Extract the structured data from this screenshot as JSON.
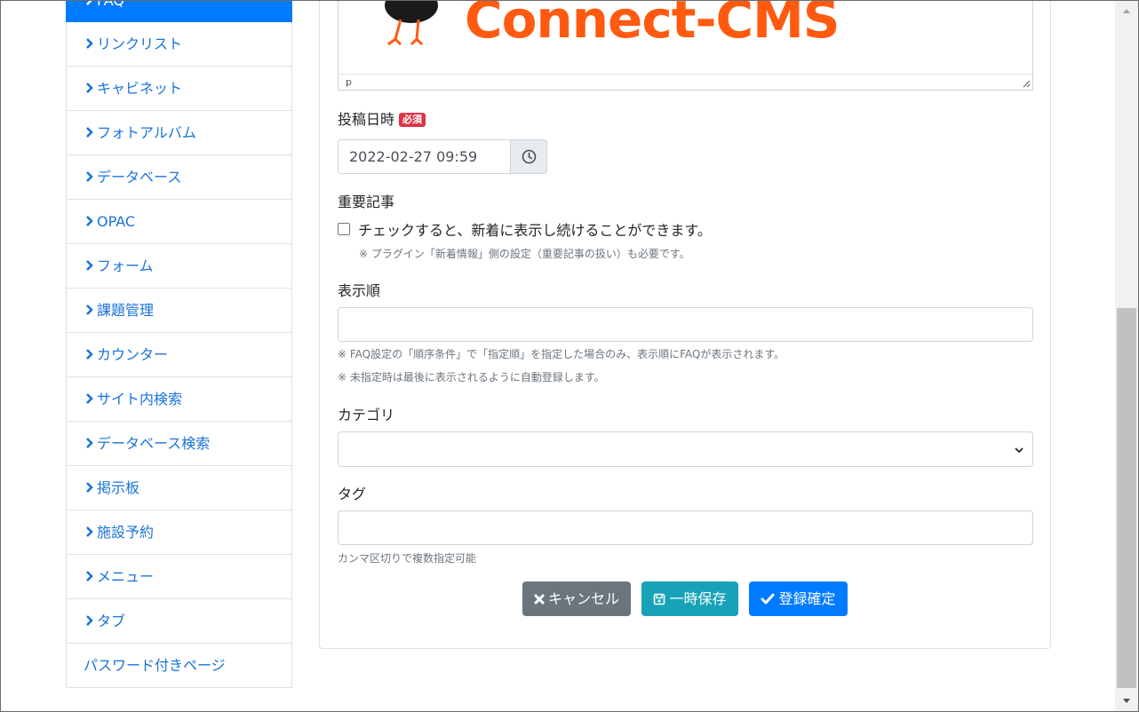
{
  "sidebar": {
    "items": [
      {
        "label": "FAQ",
        "active": true
      },
      {
        "label": "リンクリスト"
      },
      {
        "label": "キャビネット"
      },
      {
        "label": "フォトアルバム"
      },
      {
        "label": "データベース"
      },
      {
        "label": "OPAC"
      },
      {
        "label": "フォーム"
      },
      {
        "label": "課題管理"
      },
      {
        "label": "カウンター"
      },
      {
        "label": "サイト内検索"
      },
      {
        "label": "データベース検索"
      },
      {
        "label": "掲示板"
      },
      {
        "label": "施設予約"
      },
      {
        "label": "メニュー"
      },
      {
        "label": "タブ"
      },
      {
        "label": "パスワード付きページ",
        "plain": true
      }
    ]
  },
  "editor": {
    "logo_text": "Connect-CMS",
    "status_path": "p"
  },
  "form": {
    "posted_at": {
      "label": "投稿日時",
      "required_badge": "必須",
      "value": "2022-02-27 09:59"
    },
    "important": {
      "label": "重要記事",
      "checkbox_label": "チェックすると、新着に表示し続けることができます。",
      "note": "※ プラグイン「新着情報」側の設定（重要記事の扱い）も必要です。"
    },
    "display_order": {
      "label": "表示順",
      "value": "",
      "note1": "※ FAQ設定の「順序条件」で「指定順」を指定した場合のみ、表示順にFAQが表示されます。",
      "note2": "※ 未指定時は最後に表示されるように自動登録します。"
    },
    "category": {
      "label": "カテゴリ",
      "selected": ""
    },
    "tags": {
      "label": "タグ",
      "value": "",
      "note": "カンマ区切りで複数指定可能"
    }
  },
  "buttons": {
    "cancel": "キャンセル",
    "temp_save": "一時保存",
    "confirm": "登録確定"
  },
  "colors": {
    "primary": "#007bff",
    "secondary": "#6c757d",
    "info": "#17a2b8",
    "danger": "#dc3545",
    "link": "#1a73d9",
    "logo": "#ff5a10"
  }
}
